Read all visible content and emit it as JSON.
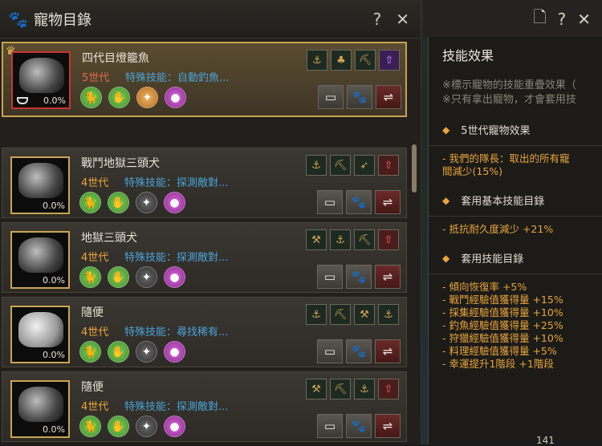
{
  "window": {
    "title": "寵物目錄",
    "help": "?",
    "close": "✕"
  },
  "pets": [
    {
      "name": "四代目燈籠魚",
      "gen": "5世代",
      "skill": "特殊技能：自動釣魚...",
      "pct": "0.0%",
      "selected": true
    },
    {
      "name": "戰鬥地獄三頭犬",
      "gen": "4世代",
      "skill": "特殊技能：探測敵對...",
      "pct": "0.0%"
    },
    {
      "name": "地獄三頭犬",
      "gen": "4世代",
      "skill": "特殊技能：探測敵對...",
      "pct": "0.0%"
    },
    {
      "name": "隨便",
      "gen": "4世代",
      "skill": "特殊技能：尋找稀有...",
      "pct": "0.0%"
    },
    {
      "name": "隨便",
      "gen": "4世代",
      "skill": "特殊技能：探測敵對...",
      "pct": "0.0%"
    }
  ],
  "right": {
    "title": "技能效果",
    "note1": "※標示寵物的技能重疊效果（",
    "note2": "※只有拿出寵物，才會套用技",
    "s1": "5世代寵物效果",
    "s1_line1": "- 我們的隊長：取出的所有寵",
    "s1_line2": "間減少(15%)",
    "s2": "套用基本技能目錄",
    "s2_line": "- 抵抗耐久度減少 +21%",
    "s3": "套用技能目錄",
    "effects": [
      "- 傾向恢復率 +5%",
      "- 戰鬥經驗值獲得量 +15%",
      "- 採集經驗值獲得量 +10%",
      "- 釣魚經驗值獲得量 +25%",
      "- 狩獵經驗值獲得量 +10%",
      "- 料理經驗值獲得量 +5%",
      "- 幸運提升1階段 +1階段"
    ],
    "bottom": "141"
  },
  "colors": {
    "accent": "#e9a53a",
    "skill_blue": "#4aa3d8",
    "gen5": "#e06a4a"
  }
}
